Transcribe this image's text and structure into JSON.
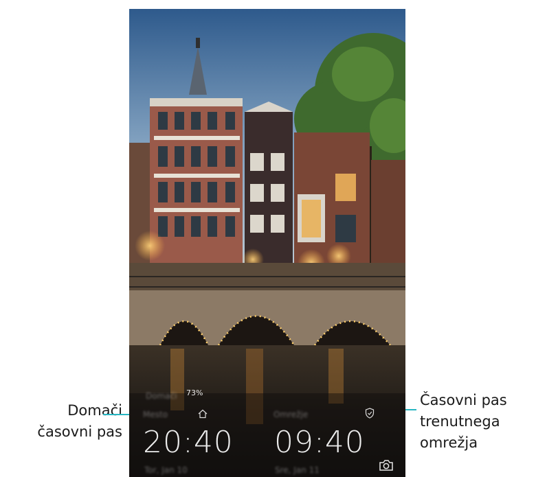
{
  "callouts": {
    "left_line1": "Domači",
    "left_line2": "časovni pas",
    "right_line1": "Časovni pas",
    "right_line2": "trenutnega",
    "right_line3": "omrežja"
  },
  "lockscreen": {
    "battery": "73%",
    "home_time": "20:40",
    "network_time": "09:40"
  },
  "icons": {
    "home": "home-icon",
    "network": "shield-icon",
    "camera": "camera-icon"
  },
  "colors": {
    "leader": "#27b6c2"
  }
}
